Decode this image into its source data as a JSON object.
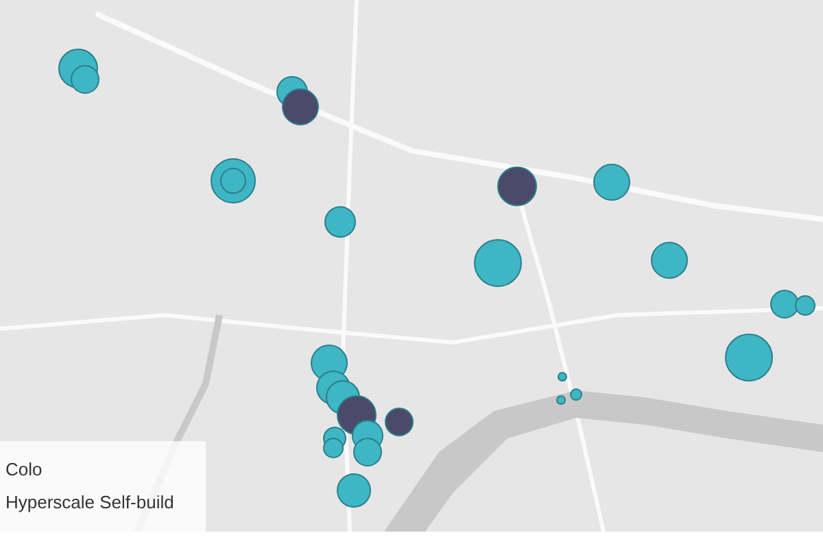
{
  "legend": [
    "Colo",
    "Hyperscale Self-build"
  ],
  "markers": [
    {
      "color": "#3fb6c4"
    },
    {
      "color": "#3fb6c4"
    },
    {
      "color": "#3fb6c4"
    },
    {
      "color": "#4b4a6b"
    },
    {
      "color": "#3fb6c4"
    },
    {
      "color": "#3fb6c4"
    },
    {
      "color": "#3fb6c4"
    },
    {
      "color": "#4b4a6b"
    },
    {
      "color": "#3fb6c4"
    },
    {
      "color": "#3fb6c4"
    },
    {
      "color": "#3fb6c4"
    },
    {
      "color": "#3fb6c4"
    },
    {
      "color": "#3fb6c4"
    },
    {
      "color": "#3fb6c4"
    },
    {
      "color": "#3fb6c4"
    },
    {
      "color": "#3fb6c4"
    },
    {
      "color": "#3fb6c4"
    },
    {
      "color": "#4b4a6b"
    },
    {
      "color": "#4b4a6b"
    },
    {
      "color": "#3fb6c4"
    },
    {
      "color": "#3fb6c4"
    },
    {
      "color": "#3fb6c4"
    },
    {
      "color": "#3fb6c4"
    },
    {
      "color": "#3fb6c4"
    },
    {
      "color": "#3fb6c4"
    },
    {
      "color": "#3fb6c4"
    },
    {
      "color": "#3fb6c4"
    }
  ]
}
